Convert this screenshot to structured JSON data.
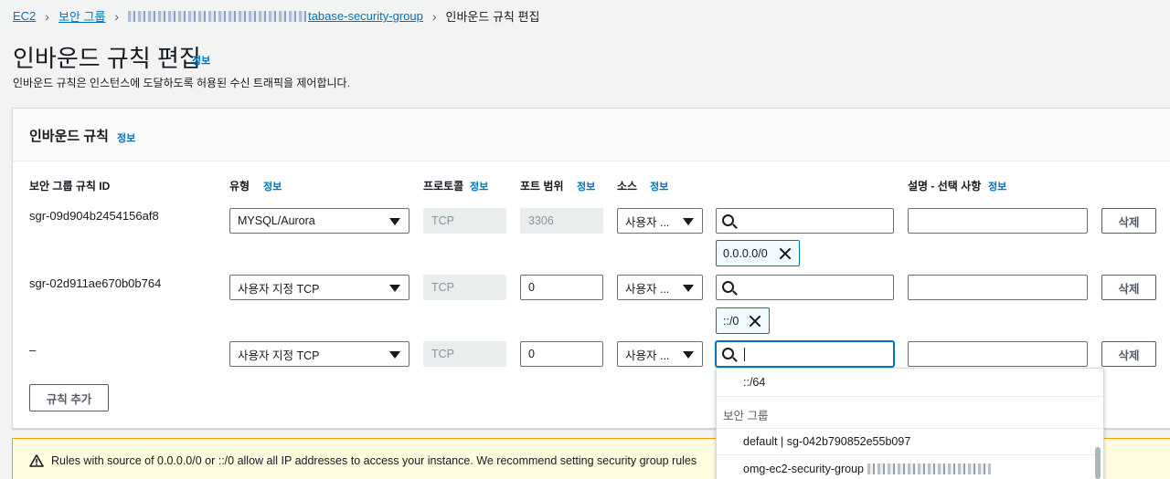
{
  "breadcrumb": {
    "ec2": "EC2",
    "security_groups": "보안 그룹",
    "sg_name_suffix": "tabase-security-group",
    "current": "인바운드 규칙 편집"
  },
  "page": {
    "title": "인바운드 규칙 편집",
    "info_link": "정보",
    "description": "인바운드 규칙은 인스턴스에 도달하도록 허용된 수신 트래픽을 제어합니다."
  },
  "panel": {
    "title": "인바운드 규칙",
    "info_link": "정보",
    "columns": {
      "rule_id": "보안 그룹 규칙 ID",
      "type": "유형",
      "protocol": "프로토콜",
      "port_range": "포트 범위",
      "source": "소스",
      "description": "설명 - 선택 사항",
      "info": "정보"
    },
    "rows": [
      {
        "rule_id": "sgr-09d904b2454156af8",
        "type": "MYSQL/Aurora",
        "protocol": "TCP",
        "port": "3306",
        "source_type": "사용자 ...",
        "source_search": "",
        "token": "0.0.0.0/0",
        "description": "",
        "delete": "삭제"
      },
      {
        "rule_id": "sgr-02d911ae670b0b764",
        "type": "사용자 지정 TCP",
        "protocol": "TCP",
        "port": "0",
        "source_type": "사용자 ...",
        "source_search": "",
        "token": "::/0",
        "description": "",
        "delete": "삭제"
      },
      {
        "rule_id": "–",
        "type": "사용자 지정 TCP",
        "protocol": "TCP",
        "port": "0",
        "source_type": "사용자 ...",
        "source_search": "",
        "description": "",
        "delete": "삭제"
      }
    ],
    "add_rule": "규칙 추가"
  },
  "dropdown": {
    "cidr_option": "::/64",
    "group_header": "보안 그룹",
    "options": [
      "default | sg-042b790852e55b097",
      "omg-ec2-security-group"
    ]
  },
  "warning": {
    "text": "Rules with source of 0.0.0.0/0 or ::/0 allow all IP addresses to access your instance. We recommend setting security group rules"
  }
}
